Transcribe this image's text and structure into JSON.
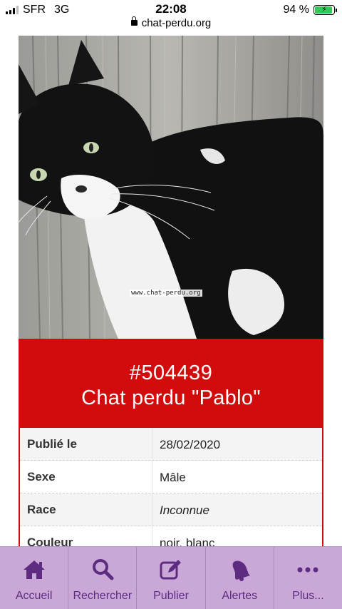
{
  "status_bar": {
    "carrier": "SFR",
    "network": "3G",
    "time": "22:08",
    "battery": "94 %",
    "battery_level": 0.94,
    "battery_color": "#34c759"
  },
  "url_bar": {
    "domain": "chat-perdu.org",
    "icon": "lock-icon"
  },
  "photo": {
    "watermark": "www.chat-perdu.org"
  },
  "banner": {
    "id": "#504439",
    "title": "Chat perdu \"Pablo\"",
    "color": "#d20c0c"
  },
  "details": {
    "rows": [
      {
        "label": "Publié le",
        "value": "28/02/2020"
      },
      {
        "label": "Sexe",
        "value": "Mâle"
      },
      {
        "label": "Race",
        "value": "Inconnue"
      },
      {
        "label": "Couleur",
        "value": "noir, blanc"
      }
    ]
  },
  "bottom_nav": {
    "background": "#c9a8d8",
    "accent": "#5d2c81",
    "items": [
      {
        "label": "Accueil",
        "icon": "home-icon"
      },
      {
        "label": "Rechercher",
        "icon": "search-icon"
      },
      {
        "label": "Publier",
        "icon": "edit-icon"
      },
      {
        "label": "Alertes",
        "icon": "bell-icon"
      },
      {
        "label": "Plus...",
        "icon": "more-icon"
      }
    ]
  }
}
